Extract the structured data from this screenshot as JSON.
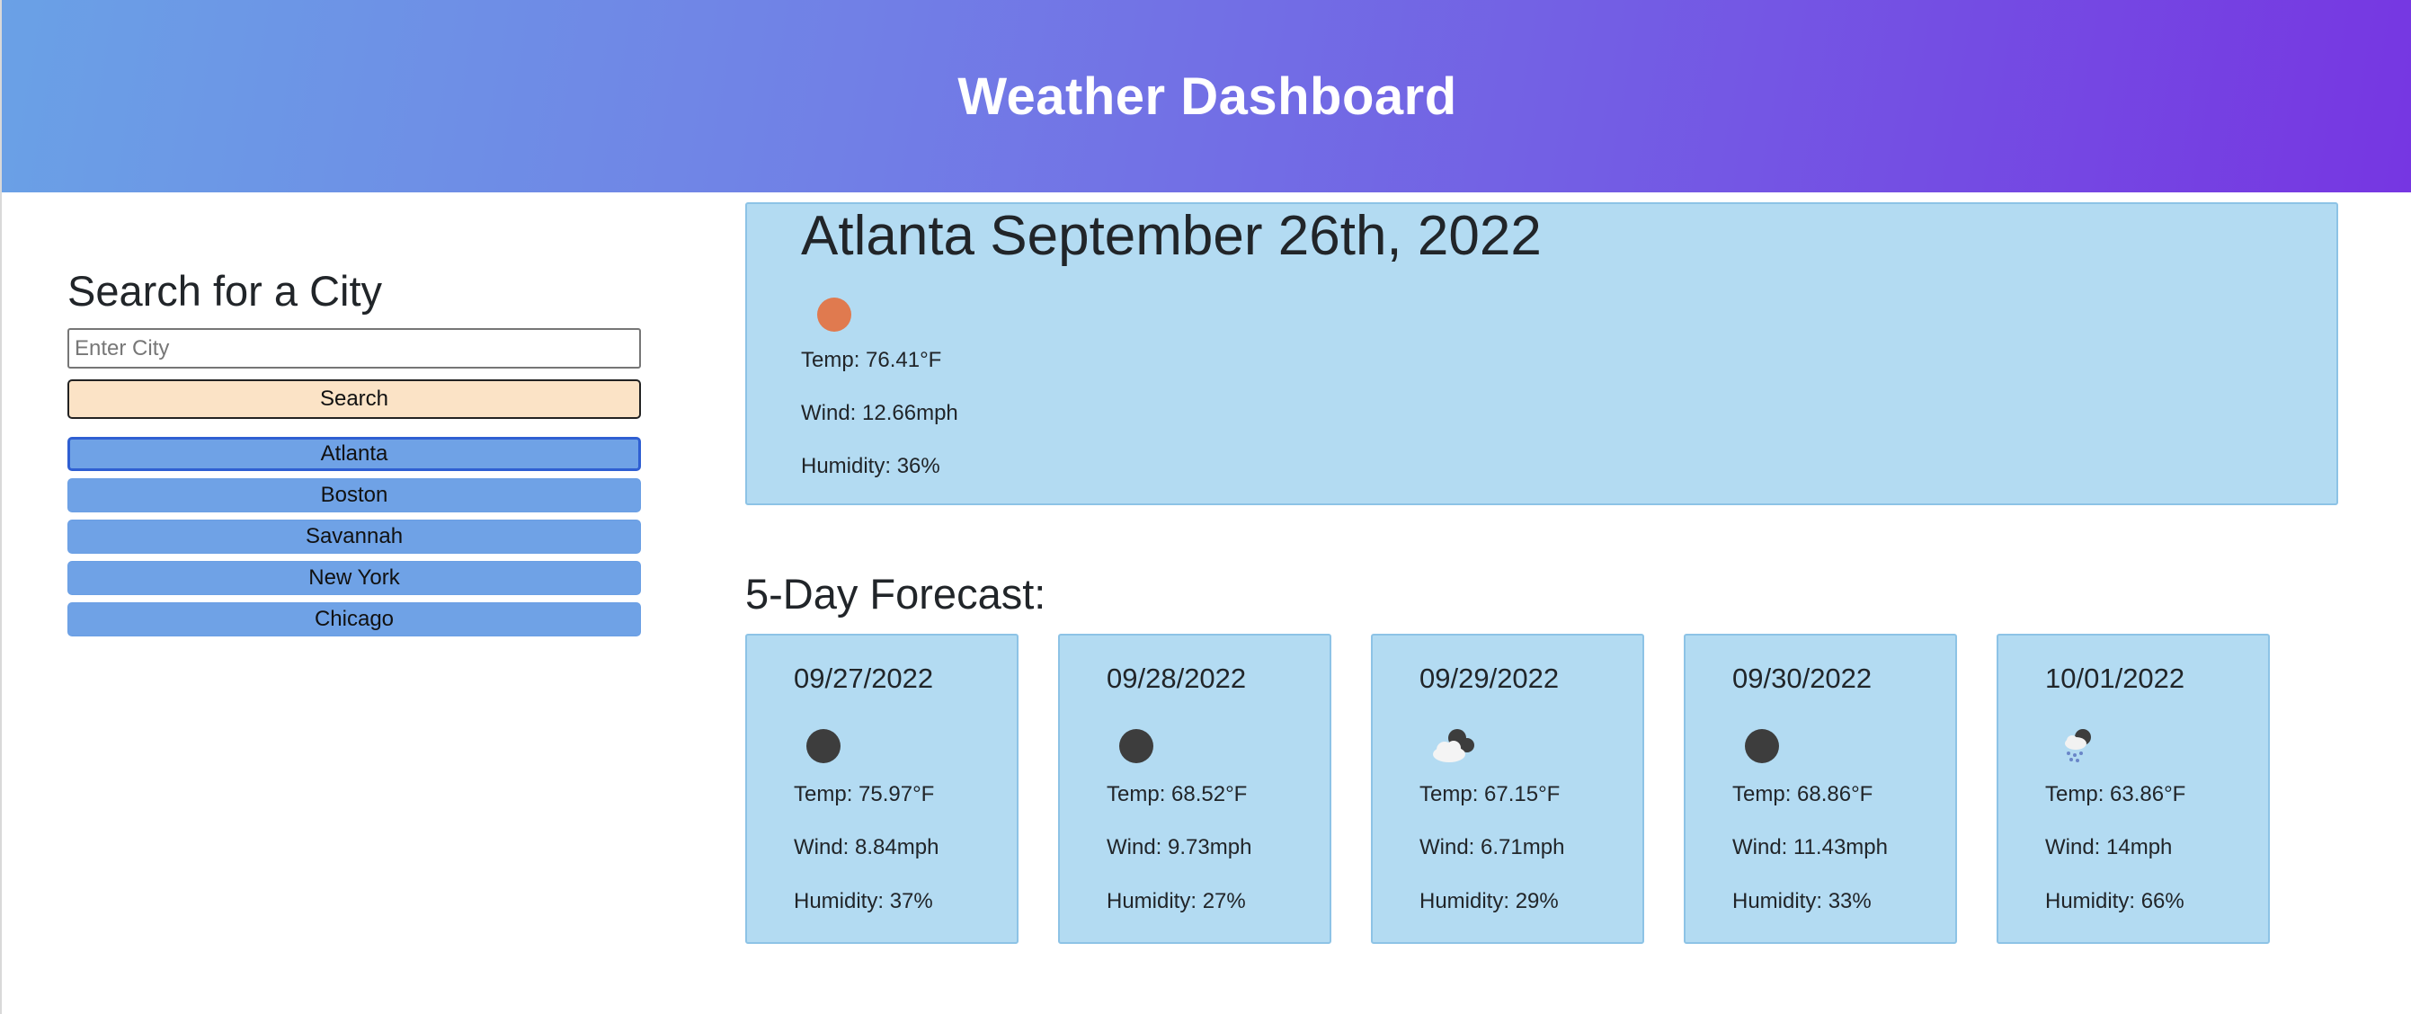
{
  "header": {
    "title": "Weather Dashboard"
  },
  "search": {
    "title": "Search for a City",
    "placeholder": "Enter City",
    "value": "",
    "button_label": "Search"
  },
  "history": [
    "Atlanta",
    "Boston",
    "Savannah",
    "New York",
    "Chicago"
  ],
  "current": {
    "title": "Atlanta September 26th, 2022",
    "icon": "sun-icon",
    "temp": "Temp: 76.41°F",
    "wind": "Wind: 12.66mph",
    "humidity": "Humidity: 36%"
  },
  "forecast": {
    "heading": "5-Day Forecast:",
    "days": [
      {
        "date": "09/27/2022",
        "icon": "clear-night-icon",
        "temp": "Temp: 75.97°F",
        "wind": "Wind: 8.84mph",
        "humidity": "Humidity: 37%"
      },
      {
        "date": "09/28/2022",
        "icon": "clear-night-icon",
        "temp": "Temp: 68.52°F",
        "wind": "Wind: 9.73mph",
        "humidity": "Humidity: 27%"
      },
      {
        "date": "09/29/2022",
        "icon": "partly-cloudy-night-icon",
        "temp": "Temp: 67.15°F",
        "wind": "Wind: 6.71mph",
        "humidity": "Humidity: 29%"
      },
      {
        "date": "09/30/2022",
        "icon": "clear-night-icon",
        "temp": "Temp: 68.86°F",
        "wind": "Wind: 11.43mph",
        "humidity": "Humidity: 33%"
      },
      {
        "date": "10/01/2022",
        "icon": "rain-night-icon",
        "temp": "Temp: 63.86°F",
        "wind": "Wind: 14mph",
        "humidity": "Humidity: 66%"
      }
    ]
  },
  "colors": {
    "header_gradient_start": "#6aa1e6",
    "header_gradient_end": "#7636e2",
    "card_bg": "#b3dbf2",
    "search_button": "#fbe3c6",
    "history_button": "#6fa2e6",
    "sun": "#e07a4f"
  }
}
